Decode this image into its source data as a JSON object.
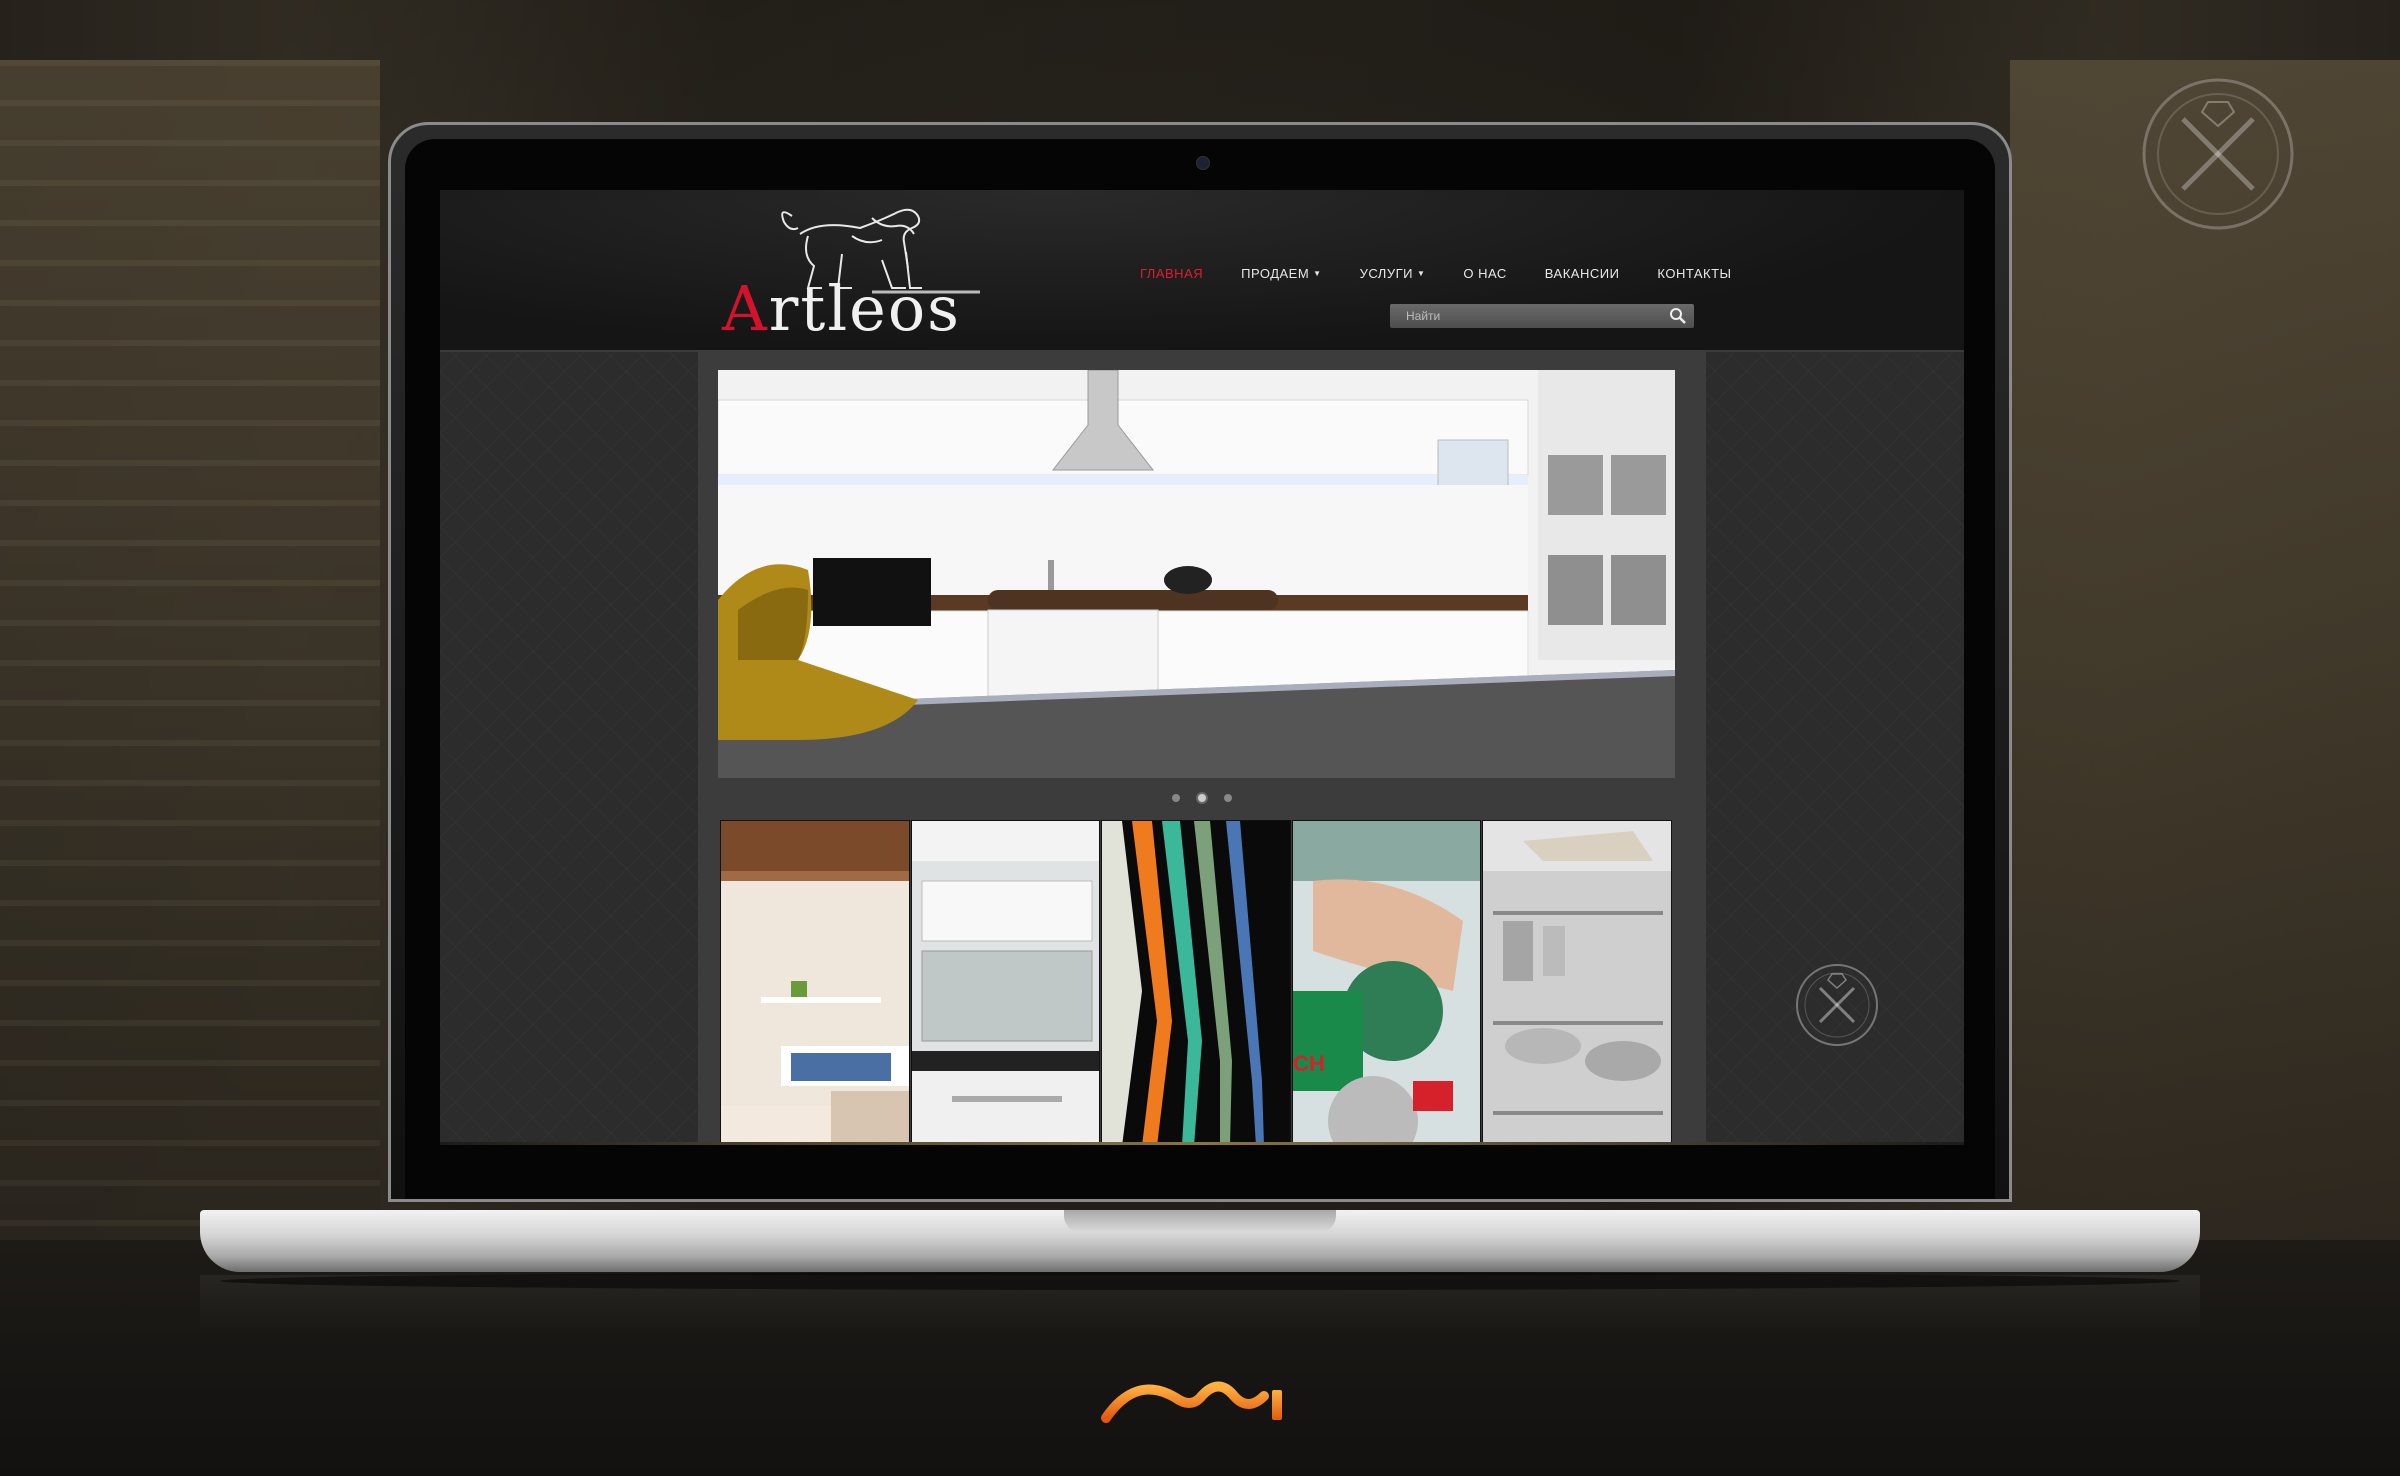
{
  "site": {
    "logo_text_first": "A",
    "logo_text_rest": "rtleos",
    "nav": [
      {
        "label": "ГЛАВНАЯ",
        "active": true,
        "dropdown": false
      },
      {
        "label": "ПРОДАЕМ",
        "active": false,
        "dropdown": true
      },
      {
        "label": "УСЛУГИ",
        "active": false,
        "dropdown": true
      },
      {
        "label": "О НАС",
        "active": false,
        "dropdown": false
      },
      {
        "label": "ВАКАНСИИ",
        "active": false,
        "dropdown": false
      },
      {
        "label": "КОНТАКТЫ",
        "active": false,
        "dropdown": false
      }
    ],
    "search": {
      "placeholder": "Найти"
    },
    "slider": {
      "slides": 3,
      "active_index": 1
    },
    "tiles": [
      {
        "name": "interior-shelves"
      },
      {
        "name": "kitchen-cabinets"
      },
      {
        "name": "color-panels"
      },
      {
        "name": "power-tool"
      },
      {
        "name": "kitchen-storage"
      }
    ]
  },
  "colors": {
    "accent": "#e11d2d",
    "nav_text": "#e8e8e8",
    "brand_orange": "#f07a1e"
  },
  "icons": [
    "search-icon",
    "lion-logo-icon",
    "diamond-badge-icon",
    "brand-wave-logo-icon"
  ]
}
